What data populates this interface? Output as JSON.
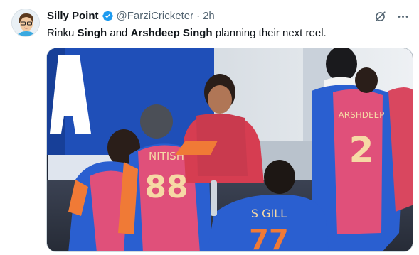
{
  "author": {
    "name": "Silly Point",
    "handle": "@FarziCricketer",
    "separator": "·",
    "time": "2h",
    "verified": true
  },
  "tweet": {
    "text_parts": [
      {
        "text": "Rinku ",
        "bold": false
      },
      {
        "text": "Singh",
        "bold": true
      },
      {
        "text": " and ",
        "bold": false
      },
      {
        "text": "Arshdeep Singh",
        "bold": true
      },
      {
        "text": " planning their next reel.",
        "bold": false
      }
    ]
  },
  "media": {
    "jersey_texts": {
      "left_player_name": "NITISH",
      "left_player_number": "88",
      "right_player_name": "ARSHDEEP",
      "right_player_number": "2",
      "front_player_name": "S GILL",
      "front_player_number": "77"
    }
  },
  "icons": {
    "grok": "grok-icon",
    "more": "more-icon",
    "verified": "verified-badge-icon"
  },
  "colors": {
    "verified_blue": "#1d9bf0",
    "secondary_text": "#536471",
    "jersey_pink": "#e0507a",
    "jersey_blue": "#2a5fd0"
  }
}
